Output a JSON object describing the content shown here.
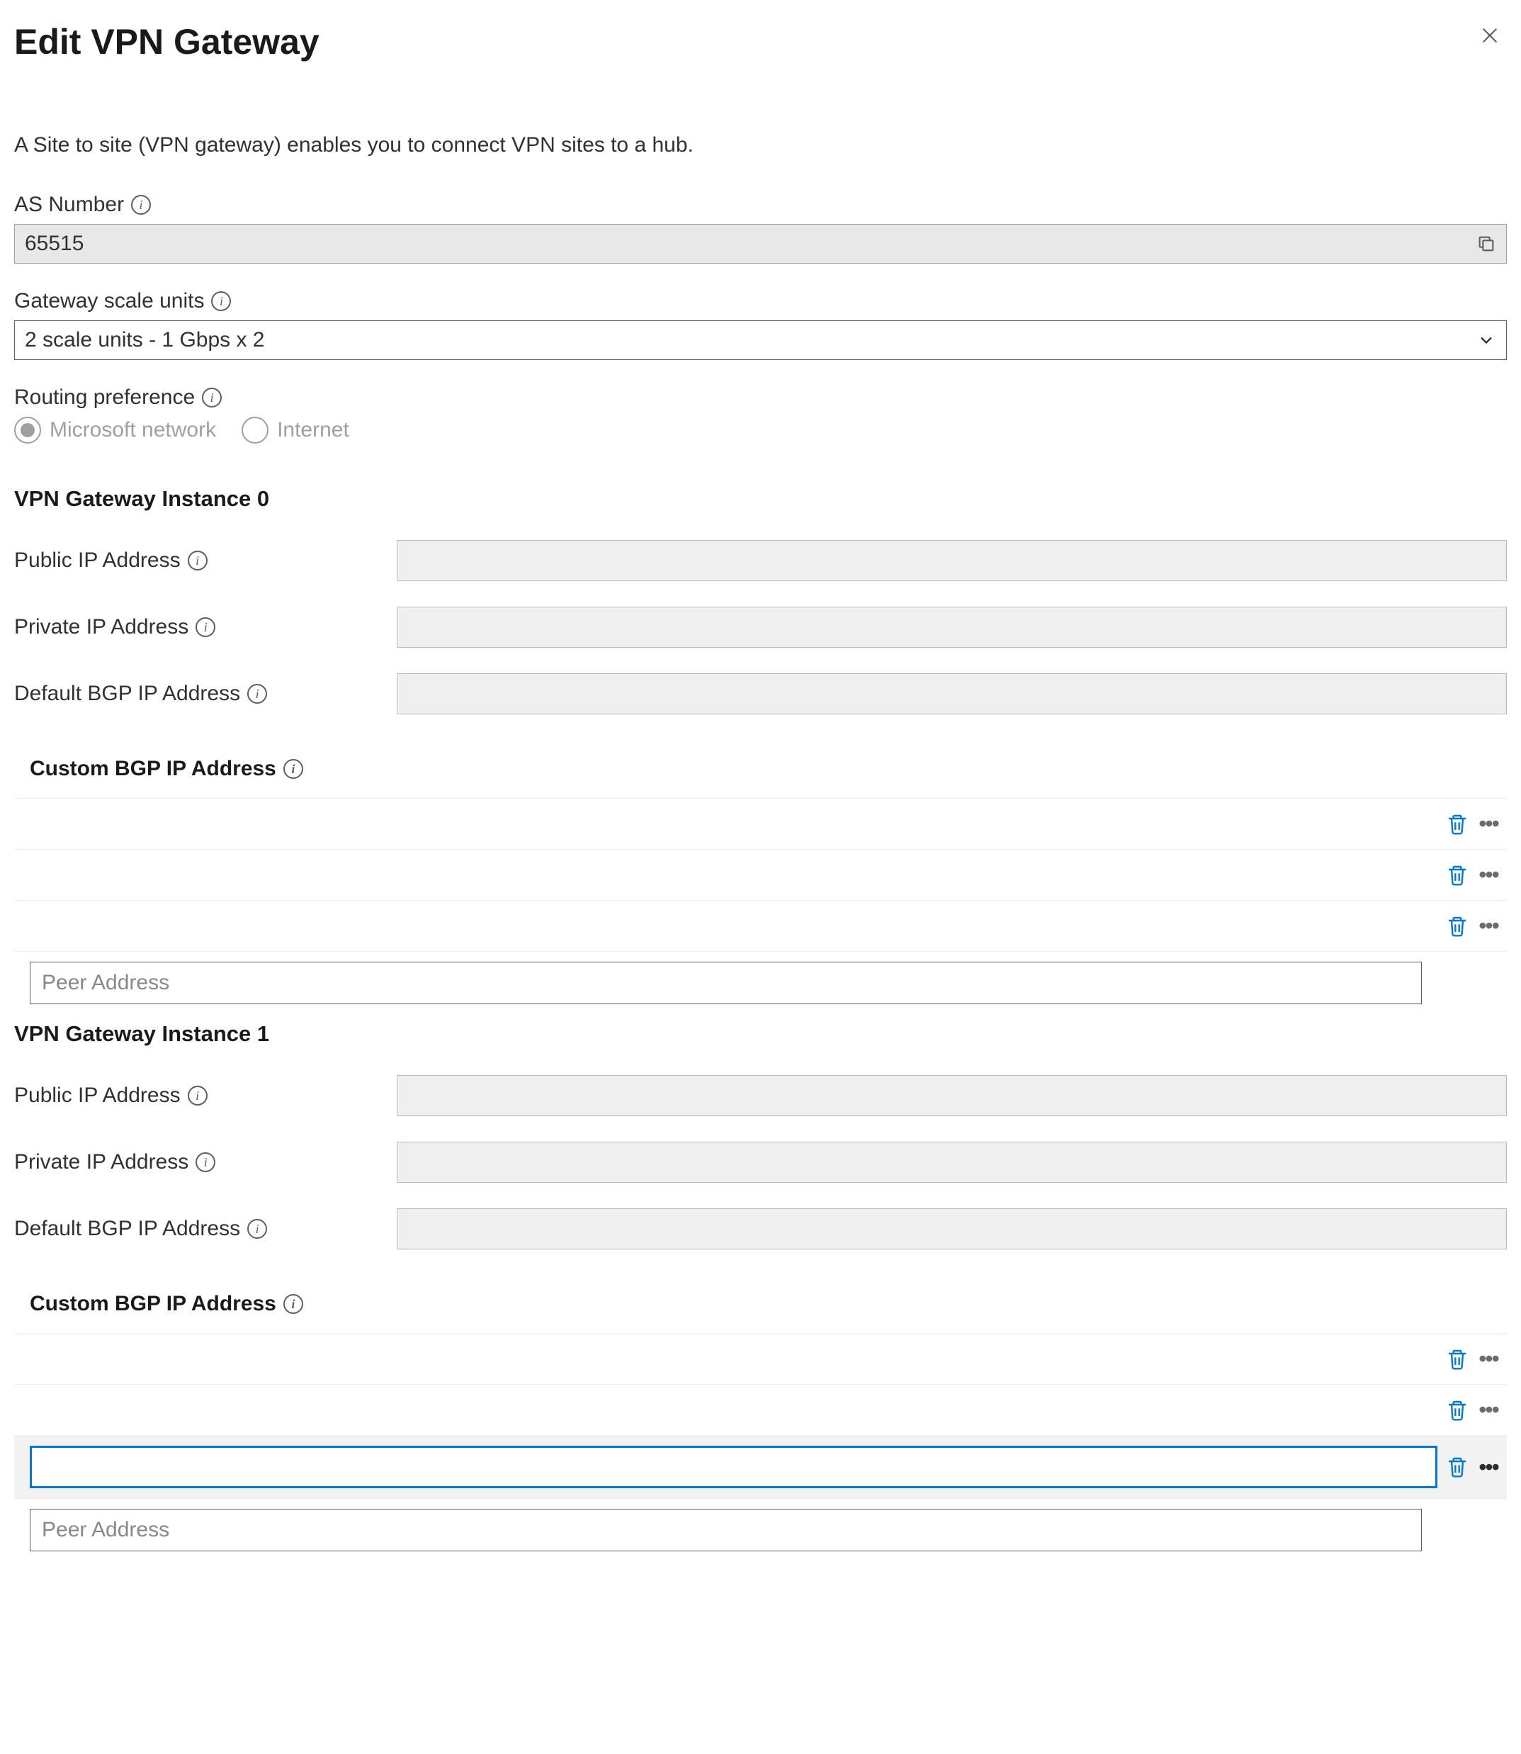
{
  "header": {
    "title": "Edit VPN Gateway"
  },
  "description": "A Site to site (VPN gateway) enables you to connect VPN sites to a hub.",
  "asNumber": {
    "label": "AS Number",
    "value": "65515"
  },
  "gatewayScaleUnits": {
    "label": "Gateway scale units",
    "value": "2 scale units - 1 Gbps x 2"
  },
  "routingPreference": {
    "label": "Routing preference",
    "options": {
      "microsoft": "Microsoft network",
      "internet": "Internet"
    }
  },
  "instance0": {
    "title": "VPN Gateway Instance 0",
    "publicIp": {
      "label": "Public IP Address",
      "value": ""
    },
    "privateIp": {
      "label": "Private IP Address",
      "value": ""
    },
    "defaultBgp": {
      "label": "Default BGP IP Address",
      "value": ""
    },
    "customBgpHeader": "Custom BGP IP Address",
    "peerPlaceholder": "Peer Address"
  },
  "instance1": {
    "title": "VPN Gateway Instance 1",
    "publicIp": {
      "label": "Public IP Address",
      "value": ""
    },
    "privateIp": {
      "label": "Private IP Address",
      "value": ""
    },
    "defaultBgp": {
      "label": "Default BGP IP Address",
      "value": ""
    },
    "customBgpHeader": "Custom BGP IP Address",
    "peerPlaceholder": "Peer Address"
  }
}
